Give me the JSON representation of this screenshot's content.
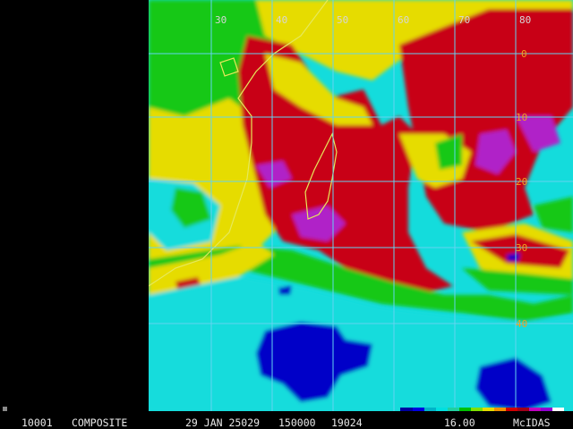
{
  "map": {
    "longitude_labels": [
      "30",
      "40",
      "50",
      "60",
      "70",
      "80"
    ],
    "latitude_labels": [
      "0",
      "10",
      "20",
      "30",
      "40"
    ],
    "colors": {
      "cold_cloud_magenta": "#b020c8",
      "hot_red": "#c80014",
      "warm_yellow": "#e6dc00",
      "moderate_green": "#14c814",
      "cool_cyan": "#14dcdc",
      "dry_blue": "#0000c8",
      "grid": "#63d4f0",
      "coastline": "#e6e85a"
    }
  },
  "status": {
    "station_id": "10001",
    "product": "COMPOSITE",
    "date": "29 JAN 25029",
    "time": "150000",
    "code": "19024",
    "value": "16.00",
    "source": "McIDAS"
  },
  "colorbar_colors": [
    "#0000a0",
    "#0000e0",
    "#00b4c8",
    "#00e0e0",
    "#20d0a0",
    "#00c000",
    "#80e000",
    "#e6dc00",
    "#f09000",
    "#d00000",
    "#a00018",
    "#c000c0",
    "#9000d0",
    "#ffffff"
  ]
}
